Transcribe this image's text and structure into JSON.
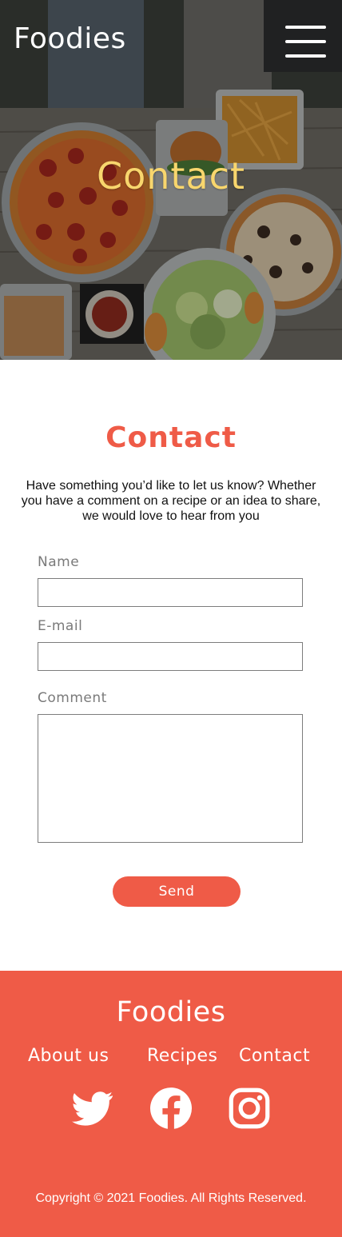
{
  "header": {
    "brand": "Foodies",
    "menu_icon": "hamburger-menu-icon",
    "hero_title": "Contact"
  },
  "contact": {
    "title": "Contact",
    "intro": "Have something you’d like to let us know? Whether you have a comment on a recipe or an idea to share, we would love to hear from you",
    "fields": {
      "name": {
        "label": "Name",
        "value": ""
      },
      "email": {
        "label": "E-mail",
        "value": ""
      },
      "comment": {
        "label": "Comment",
        "value": ""
      }
    },
    "send_label": "Send"
  },
  "footer": {
    "brand": "Foodies",
    "links": [
      "About us",
      "Recipes",
      "Contact"
    ],
    "social": [
      "twitter-icon",
      "facebook-icon",
      "instagram-icon"
    ],
    "copyright": "Copyright © 2021 Foodies. All Rights Reserved."
  },
  "colors": {
    "accent": "#ef5b47",
    "hero_title": "#f8d66d",
    "label_gray": "#7a7a7a",
    "white": "#ffffff"
  }
}
